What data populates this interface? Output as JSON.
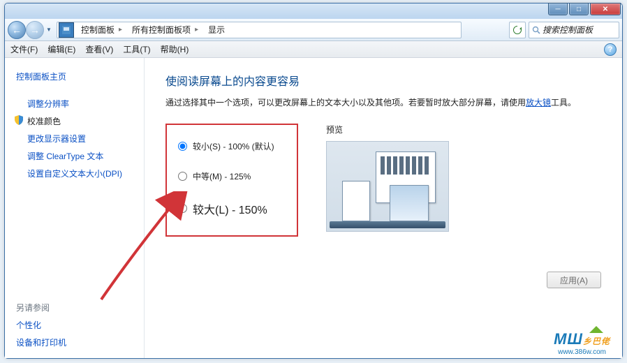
{
  "breadcrumbs": {
    "item1": "控制面板",
    "item2": "所有控制面板项",
    "item3": "显示"
  },
  "search": {
    "placeholder": "搜索控制面板"
  },
  "menu": {
    "file": "文件(F)",
    "edit": "编辑(E)",
    "view": "查看(V)",
    "tools": "工具(T)",
    "help": "帮助(H)",
    "helpicon": "?"
  },
  "sidebar": {
    "home": "控制面板主页",
    "links": [
      "调整分辨率",
      "校准颜色",
      "更改显示器设置",
      "调整 ClearType 文本",
      "设置自定义文本大小(DPI)"
    ],
    "seealso": "另请参阅",
    "see": [
      "个性化",
      "设备和打印机"
    ]
  },
  "main": {
    "title": "使阅读屏幕上的内容更容易",
    "desc1": "通过选择其中一个选项，可以更改屏幕上的文本大小以及其他项。若要暂时放大部分屏幕，请使用",
    "link": "放大镜",
    "desc2": "工具。",
    "opt1": "较小(S) - 100% (默认)",
    "opt2": "中等(M) - 125%",
    "opt3": "较大(L) - 150%",
    "preview": "预览",
    "apply": "应用(A)"
  },
  "watermark": {
    "brand": "乡巴佬",
    "url": "www.386w.com"
  }
}
